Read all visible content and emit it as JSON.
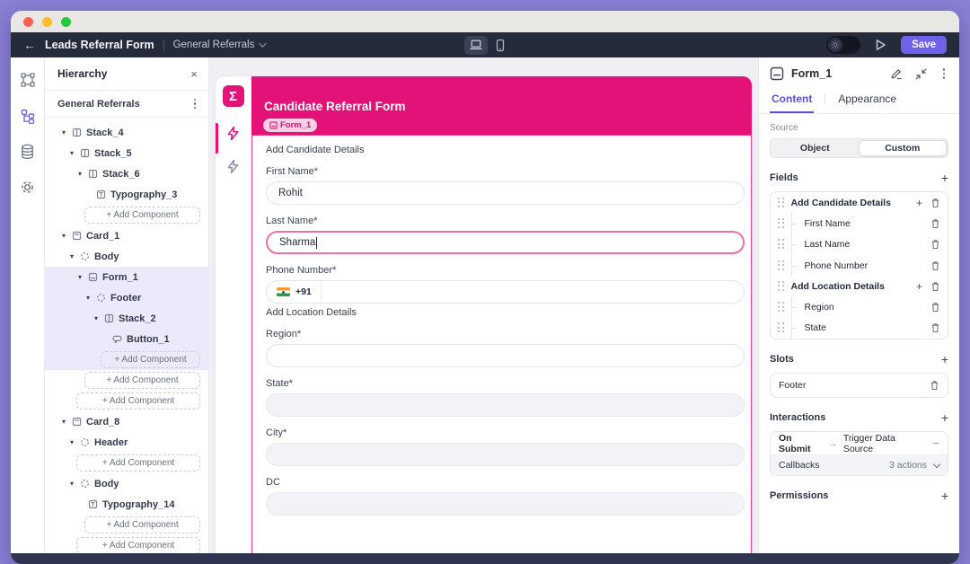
{
  "colors": {
    "brand_pink": "#E31279",
    "accent_purple": "#6F61E8",
    "active_tab_purple": "#5D50D3",
    "tree_highlight": "#ECE9FA"
  },
  "toolbar": {
    "title": "Leads Referral Form",
    "breadcrumb": "General Referrals",
    "save_label": "Save"
  },
  "rail": {
    "items": [
      {
        "icon": "artboard"
      },
      {
        "icon": "hierarchy",
        "active": true
      },
      {
        "icon": "database"
      },
      {
        "icon": "settings"
      }
    ]
  },
  "hierarchy": {
    "title": "Hierarchy",
    "root": "General Referrals",
    "add_component_label": "+ Add Component",
    "items": [
      {
        "kind": "node",
        "label": "Stack_4",
        "icon": "stack",
        "level": 1,
        "caret": true
      },
      {
        "kind": "node",
        "label": "Stack_5",
        "icon": "stack",
        "level": 2,
        "caret": true
      },
      {
        "kind": "node",
        "label": "Stack_6",
        "icon": "stack",
        "level": 3,
        "caret": true
      },
      {
        "kind": "node",
        "label": "Typography_3",
        "icon": "typography",
        "level": 4,
        "caret": false
      },
      {
        "kind": "add",
        "level": 4
      },
      {
        "kind": "node",
        "label": "Card_1",
        "icon": "card",
        "level": 1,
        "caret": true
      },
      {
        "kind": "node",
        "label": "Body",
        "icon": "slot",
        "level": 2,
        "caret": true
      },
      {
        "kind": "node",
        "label": "Form_1",
        "icon": "form",
        "level": 3,
        "caret": true,
        "highlight": true
      },
      {
        "kind": "node",
        "label": "Footer",
        "icon": "slot",
        "level": 4,
        "caret": true,
        "highlight": true
      },
      {
        "kind": "node",
        "label": "Stack_2",
        "icon": "stack",
        "level": 5,
        "caret": true,
        "highlight": true
      },
      {
        "kind": "node",
        "label": "Button_1",
        "icon": "button",
        "level": 6,
        "caret": false,
        "highlight": true
      },
      {
        "kind": "add",
        "level": 6,
        "highlight": true
      },
      {
        "kind": "add",
        "level": 4
      },
      {
        "kind": "add",
        "level": 3
      },
      {
        "kind": "node",
        "label": "Card_8",
        "icon": "card",
        "level": 1,
        "caret": true
      },
      {
        "kind": "node",
        "label": "Header",
        "icon": "slot",
        "level": 2,
        "caret": true
      },
      {
        "kind": "add",
        "level": 3
      },
      {
        "kind": "node",
        "label": "Body",
        "icon": "slot",
        "level": 2,
        "caret": true
      },
      {
        "kind": "node",
        "label": "Typography_14",
        "icon": "typography",
        "level": 3,
        "caret": false
      },
      {
        "kind": "add",
        "level": 4
      },
      {
        "kind": "add",
        "level": 3
      }
    ]
  },
  "canvas": {
    "form_header": {
      "title": "Candidate Referral Form",
      "badge": "Form_1"
    },
    "blocks": [
      {
        "type": "section",
        "label": "Add Candidate Details"
      },
      {
        "type": "field",
        "label": "First Name*",
        "value": "Rohit",
        "state": "filled"
      },
      {
        "type": "field",
        "label": "Last Name*",
        "value": "Sharma",
        "state": "focused"
      },
      {
        "type": "field",
        "label": "Phone Number*",
        "value": "",
        "prefix": "+91",
        "flag": "india",
        "state": "phone"
      },
      {
        "type": "section",
        "label": "Add Location Details"
      },
      {
        "type": "field",
        "label": "Region*",
        "value": "",
        "state": "enabled"
      },
      {
        "type": "field",
        "label": "State*",
        "value": "",
        "state": "disabled"
      },
      {
        "type": "field",
        "label": "City*",
        "value": "",
        "state": "disabled"
      },
      {
        "type": "field",
        "label": "DC",
        "value": "",
        "state": "disabled"
      }
    ]
  },
  "inspector": {
    "title": "Form_1",
    "tabs": [
      {
        "label": "Content",
        "active": true
      },
      {
        "label": "Appearance",
        "active": false
      }
    ],
    "source": {
      "label": "Source",
      "options": [
        {
          "label": "Object",
          "selected": false
        },
        {
          "label": "Custom",
          "selected": true
        }
      ]
    },
    "fields_section": {
      "label": "Fields",
      "rows": [
        {
          "label": "Add Candidate Details",
          "group": true
        },
        {
          "label": "First Name",
          "group": false
        },
        {
          "label": "Last Name",
          "group": false
        },
        {
          "label": "Phone Number",
          "group": false
        },
        {
          "label": "Add Location Details",
          "group": true
        },
        {
          "label": "Region",
          "group": false
        },
        {
          "label": "State",
          "group": false
        }
      ]
    },
    "slots_section": {
      "label": "Slots",
      "rows": [
        {
          "label": "Footer"
        }
      ]
    },
    "interactions_section": {
      "label": "Interactions",
      "submit_row": {
        "event": "On Submit",
        "action": "Trigger Data Source"
      },
      "callbacks_row": {
        "label": "Callbacks",
        "value": "3 actions"
      }
    },
    "permissions_section": {
      "label": "Permissions"
    }
  }
}
